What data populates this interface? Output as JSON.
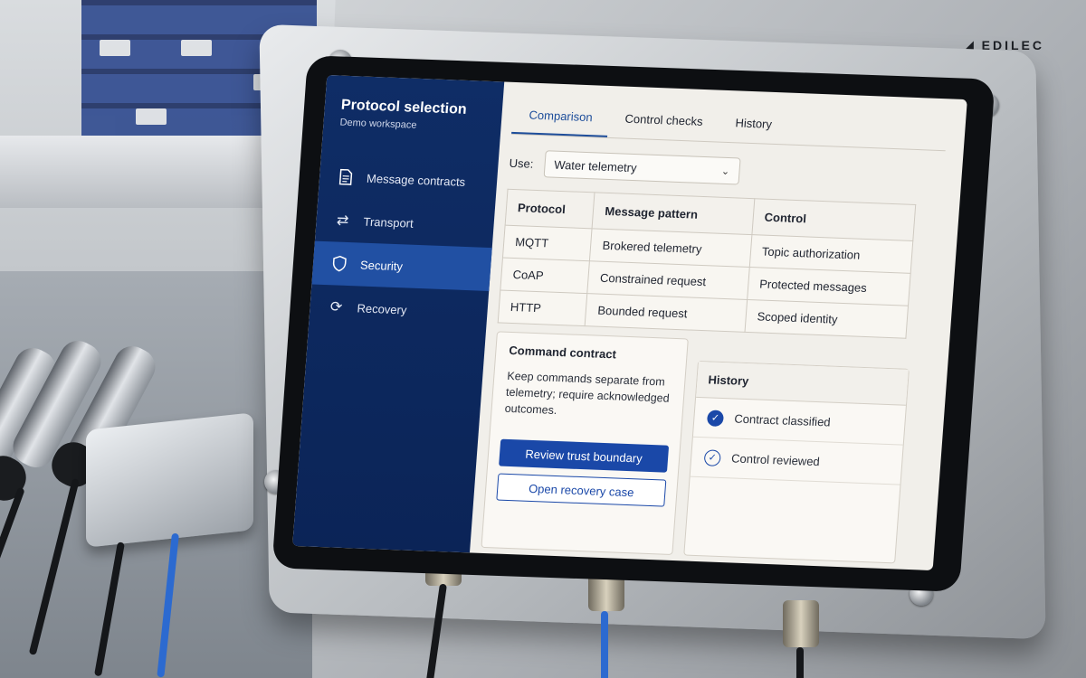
{
  "brand": {
    "logo_text": "EDILEC"
  },
  "app": {
    "title": "Protocol selection",
    "subtitle": "Demo workspace"
  },
  "sidebar": {
    "items": [
      {
        "label": "Message contracts",
        "icon": "document-icon",
        "active": false
      },
      {
        "label": "Transport",
        "icon": "arrows-icon",
        "active": false
      },
      {
        "label": "Security",
        "icon": "shield-icon",
        "active": true
      },
      {
        "label": "Recovery",
        "icon": "refresh-icon",
        "active": false
      }
    ]
  },
  "tabs": [
    {
      "label": "Comparison",
      "active": true
    },
    {
      "label": "Control checks",
      "active": false
    },
    {
      "label": "History",
      "active": false
    }
  ],
  "use": {
    "label": "Use:",
    "selected": "Water telemetry"
  },
  "table": {
    "headers": [
      "Protocol",
      "Message pattern",
      "Control"
    ],
    "rows": [
      [
        "MQTT",
        "Brokered telemetry",
        "Topic authorization"
      ],
      [
        "CoAP",
        "Constrained request",
        "Protected messages"
      ],
      [
        "HTTP",
        "Bounded request",
        "Scoped identity"
      ]
    ]
  },
  "command": {
    "title": "Command contract",
    "text": "Keep commands separate from telemetry; require acknowledged outcomes.",
    "primary_button": "Review trust boundary",
    "secondary_button": "Open recovery case"
  },
  "history": {
    "title": "History",
    "items": [
      {
        "label": "Contract classified",
        "state": "filled"
      },
      {
        "label": "Control reviewed",
        "state": "outline"
      }
    ]
  },
  "colors": {
    "sidebar": "#0f2d66",
    "accent": "#1a48a8",
    "active_nav": "#2150a3"
  }
}
